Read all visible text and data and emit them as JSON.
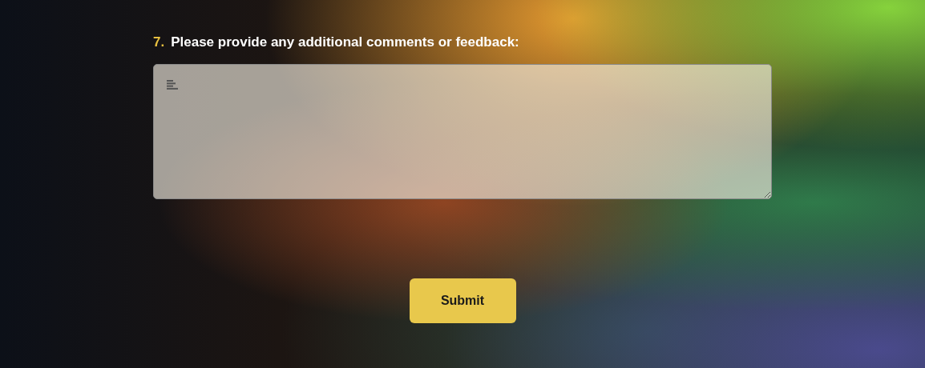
{
  "question": {
    "number": "7.",
    "text": "Please provide any additional comments or feedback:"
  },
  "submit_button": {
    "label": "Submit"
  }
}
